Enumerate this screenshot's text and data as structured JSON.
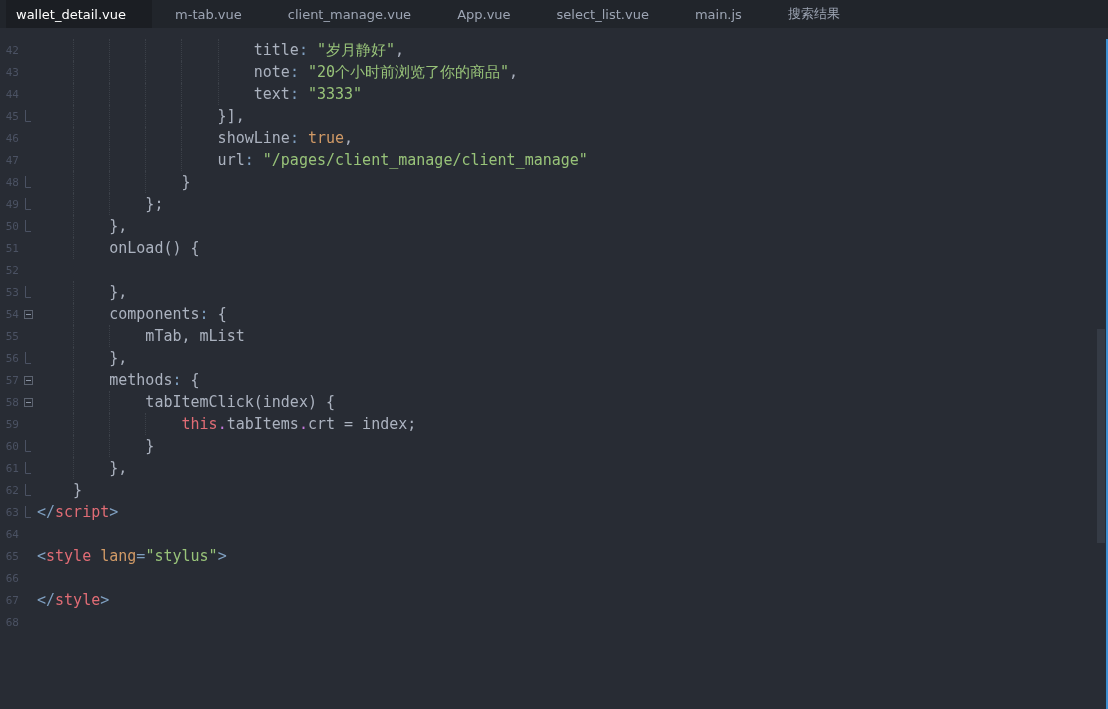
{
  "tabs": [
    {
      "label": "wallet_detail.vue",
      "selected": true
    },
    {
      "label": "m-tab.vue",
      "selected": false
    },
    {
      "label": "client_manage.vue",
      "selected": false
    },
    {
      "label": "App.vue",
      "selected": false
    },
    {
      "label": "select_list.vue",
      "selected": false
    },
    {
      "label": "main.js",
      "selected": false
    },
    {
      "label": "搜索结果",
      "selected": false
    }
  ],
  "editor": {
    "lines": [
      {
        "number": "42",
        "fold_start": false,
        "fold_end": false,
        "tokens": [
          {
            "kind": "plain",
            "text": "                        title"
          },
          {
            "kind": "punct",
            "text": ": "
          },
          {
            "kind": "string",
            "text": "\"岁月静好\""
          },
          {
            "kind": "plain",
            "text": ","
          }
        ]
      },
      {
        "number": "43",
        "fold_start": false,
        "fold_end": false,
        "tokens": [
          {
            "kind": "plain",
            "text": "                        note"
          },
          {
            "kind": "punct",
            "text": ": "
          },
          {
            "kind": "string",
            "text": "\"20个小时前浏览了你的商品\""
          },
          {
            "kind": "plain",
            "text": ","
          }
        ]
      },
      {
        "number": "44",
        "fold_start": false,
        "fold_end": false,
        "tokens": [
          {
            "kind": "plain",
            "text": "                        text"
          },
          {
            "kind": "punct",
            "text": ": "
          },
          {
            "kind": "string",
            "text": "\"3333\""
          }
        ]
      },
      {
        "number": "45",
        "fold_start": false,
        "fold_end": true,
        "tokens": [
          {
            "kind": "plain",
            "text": "                    }],"
          }
        ]
      },
      {
        "number": "46",
        "fold_start": false,
        "fold_end": false,
        "tokens": [
          {
            "kind": "plain",
            "text": "                    showLine"
          },
          {
            "kind": "punct",
            "text": ": "
          },
          {
            "kind": "keyword",
            "text": "true"
          },
          {
            "kind": "plain",
            "text": ","
          }
        ]
      },
      {
        "number": "47",
        "fold_start": false,
        "fold_end": false,
        "tokens": [
          {
            "kind": "plain",
            "text": "                    url"
          },
          {
            "kind": "punct",
            "text": ": "
          },
          {
            "kind": "string",
            "text": "\"/pages/client_manage/client_manage\""
          }
        ]
      },
      {
        "number": "48",
        "fold_start": false,
        "fold_end": true,
        "tokens": [
          {
            "kind": "plain",
            "text": "                }"
          }
        ]
      },
      {
        "number": "49",
        "fold_start": false,
        "fold_end": true,
        "tokens": [
          {
            "kind": "plain",
            "text": "            };"
          }
        ]
      },
      {
        "number": "50",
        "fold_start": false,
        "fold_end": true,
        "tokens": [
          {
            "kind": "plain",
            "text": "        },"
          }
        ]
      },
      {
        "number": "51",
        "fold_start": false,
        "fold_end": false,
        "tokens": [
          {
            "kind": "plain",
            "text": "        onLoad() {"
          }
        ]
      },
      {
        "number": "52",
        "fold_start": false,
        "fold_end": false
      },
      {
        "number": "53",
        "fold_start": false,
        "fold_end": true,
        "tokens": [
          {
            "kind": "plain",
            "text": "        },"
          }
        ]
      },
      {
        "number": "54",
        "fold_start": true,
        "fold_end": false,
        "tokens": [
          {
            "kind": "plain",
            "text": "        components"
          },
          {
            "kind": "punct",
            "text": ": "
          },
          {
            "kind": "plain",
            "text": "{"
          }
        ]
      },
      {
        "number": "55",
        "fold_start": false,
        "fold_end": false,
        "tokens": [
          {
            "kind": "plain",
            "text": "            mTab, mList"
          }
        ]
      },
      {
        "number": "56",
        "fold_start": false,
        "fold_end": true,
        "tokens": [
          {
            "kind": "plain",
            "text": "        },"
          }
        ]
      },
      {
        "number": "57",
        "fold_start": true,
        "fold_end": false,
        "tokens": [
          {
            "kind": "plain",
            "text": "        methods"
          },
          {
            "kind": "punct",
            "text": ": "
          },
          {
            "kind": "plain",
            "text": "{"
          }
        ]
      },
      {
        "number": "58",
        "fold_start": true,
        "fold_end": false,
        "tokens": [
          {
            "kind": "plain",
            "text": "            tabItemClick(index) {"
          }
        ]
      },
      {
        "number": "59",
        "fold_start": false,
        "fold_end": false,
        "tokens": [
          {
            "kind": "this",
            "text": "                this"
          },
          {
            "kind": "dot",
            "text": "."
          },
          {
            "kind": "plain",
            "text": "tabItems"
          },
          {
            "kind": "dot",
            "text": "."
          },
          {
            "kind": "plain",
            "text": "crt = index;"
          }
        ]
      },
      {
        "number": "60",
        "fold_start": false,
        "fold_end": true,
        "tokens": [
          {
            "kind": "plain",
            "text": "            }"
          }
        ]
      },
      {
        "number": "61",
        "fold_start": false,
        "fold_end": true,
        "tokens": [
          {
            "kind": "plain",
            "text": "        },"
          }
        ]
      },
      {
        "number": "62",
        "fold_start": false,
        "fold_end": true,
        "tokens": [
          {
            "kind": "plain",
            "text": "    }"
          }
        ]
      },
      {
        "number": "63",
        "fold_start": false,
        "fold_end": true,
        "tokens": [
          {
            "kind": "bracket",
            "text": "</"
          },
          {
            "kind": "tag",
            "text": "script"
          },
          {
            "kind": "bracket",
            "text": ">"
          }
        ]
      },
      {
        "number": "64",
        "fold_start": false,
        "fold_end": false
      },
      {
        "number": "65",
        "fold_start": false,
        "fold_end": false,
        "tokens": [
          {
            "kind": "bracket",
            "text": "<"
          },
          {
            "kind": "tag",
            "text": "style"
          },
          {
            "kind": "attr",
            "text": " lang"
          },
          {
            "kind": "punct",
            "text": "="
          },
          {
            "kind": "string",
            "text": "\"stylus\""
          },
          {
            "kind": "bracket",
            "text": ">"
          }
        ]
      },
      {
        "number": "66",
        "fold_start": false,
        "fold_end": false
      },
      {
        "number": "67",
        "fold_start": false,
        "fold_end": false,
        "tokens": [
          {
            "kind": "bracket",
            "text": "</"
          },
          {
            "kind": "tag",
            "text": "style"
          },
          {
            "kind": "bracket",
            "text": ">"
          }
        ]
      },
      {
        "number": "68",
        "fold_start": false,
        "fold_end": false
      }
    ]
  }
}
